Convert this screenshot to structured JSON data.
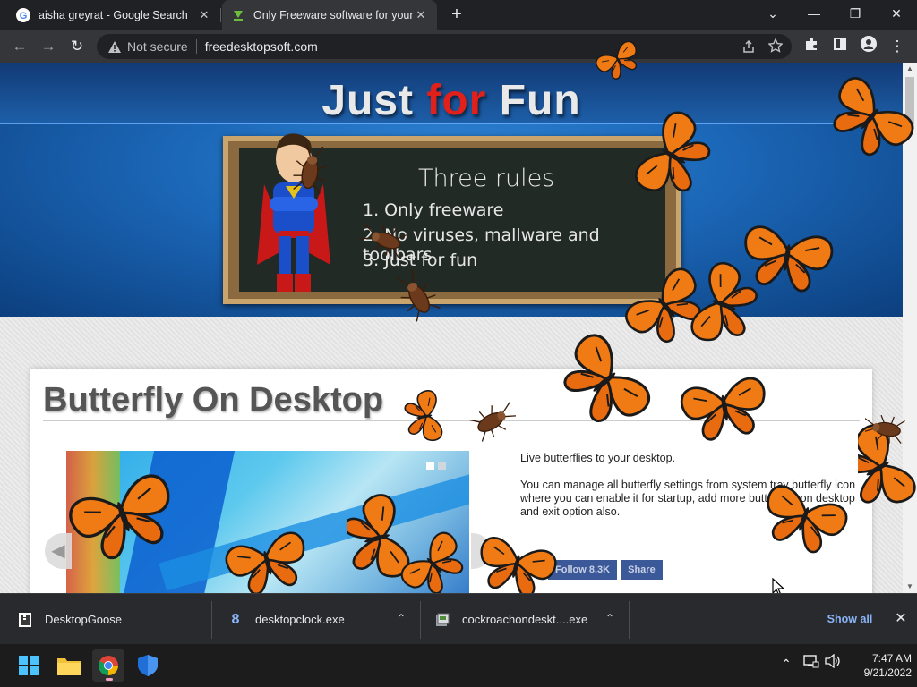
{
  "browser": {
    "tabs": [
      {
        "title": "aisha greyrat - Google Search",
        "icon": "google-g-icon",
        "active": false
      },
      {
        "title": "Only Freeware software for your",
        "icon": "download-arrow-icon",
        "active": true
      }
    ],
    "new_tab": "+",
    "window_controls": {
      "dropdown": "⌄",
      "minimize": "—",
      "restore": "❐",
      "close": "✕"
    }
  },
  "toolbar": {
    "back": "←",
    "forward": "→",
    "reload": "↻",
    "security_label": "Not secure",
    "url": "freedesktopsoft.com",
    "icons": [
      "share-icon",
      "bookmark-star-icon",
      "extensions-icon",
      "side-panel-icon",
      "profile-icon",
      "menu-icon"
    ]
  },
  "page": {
    "hero": {
      "title_part1": "Just ",
      "title_part2": "for",
      "title_part3": " Fun",
      "board_heading": "Three rules",
      "rules": [
        "1. Only freeware",
        "2. No viruses, mallware and toolbars",
        "3. Just for fun"
      ]
    },
    "product": {
      "title": "Butterfly On Desktop",
      "description1": "Live butterflies to your desktop.",
      "description2": "You can manage all butterfly settings from system tray butterfly icon where you can enable it for startup, add more butterflies on desktop and exit option also.",
      "follow_label": "Follow 8.3K",
      "share_label": "Share"
    },
    "colors": {
      "accent_red": "#e0201a",
      "hero_blue": "#1b66b6",
      "butterfly_orange": "#f07a14"
    }
  },
  "downloads": {
    "items": [
      {
        "name": "DesktopGoose",
        "icon": "zip-archive-icon"
      },
      {
        "name": "desktopclock.exe",
        "icon": "clock-app-icon"
      },
      {
        "name": "cockroachondeskt....exe",
        "icon": "installer-icon"
      }
    ],
    "show_all": "Show all",
    "close": "✕",
    "chevron": "⌃"
  },
  "taskbar": {
    "apps": [
      "windows-start-icon",
      "file-explorer-icon",
      "chrome-icon",
      "windows-security-icon"
    ],
    "tray": {
      "overflow": "⌃",
      "network": "network-icon",
      "volume": "speaker-icon"
    },
    "time": "7:47 AM",
    "date": "9/21/2022"
  }
}
